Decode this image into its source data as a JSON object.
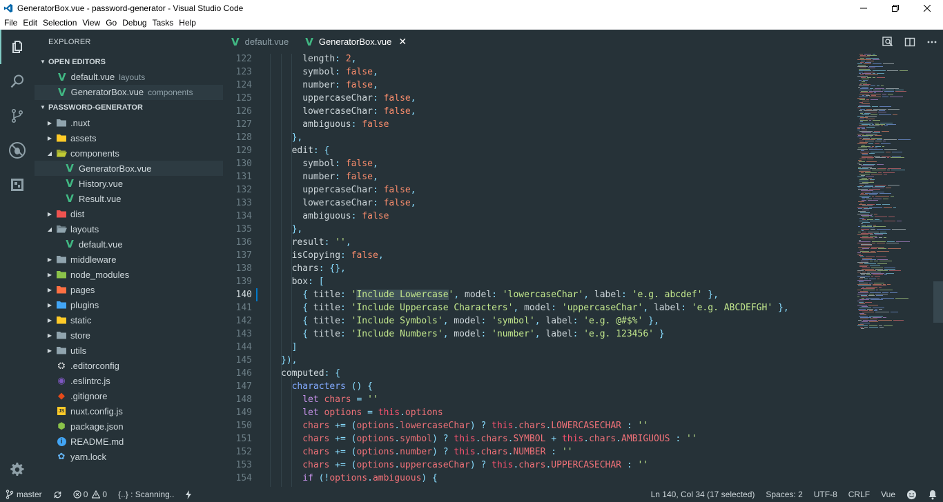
{
  "window": {
    "title": "GeneratorBox.vue - password-generator - Visual Studio Code",
    "accent": "#007acc"
  },
  "menu": [
    "File",
    "Edit",
    "Selection",
    "View",
    "Go",
    "Debug",
    "Tasks",
    "Help"
  ],
  "activity_icons": [
    "explorer-icon",
    "search-icon",
    "source-control-icon",
    "debug-icon",
    "extensions-icon",
    "settings-gear-icon"
  ],
  "sidebar": {
    "header": "EXPLORER",
    "open_editors": {
      "title": "OPEN EDITORS",
      "items": [
        {
          "name": "default.vue",
          "desc": "layouts"
        },
        {
          "name": "GeneratorBox.vue",
          "desc": "components"
        }
      ]
    },
    "project": {
      "title": "PASSWORD-GENERATOR",
      "items": [
        {
          "label": ".nuxt",
          "kind": "folder",
          "state": "closed",
          "depth": 0,
          "color": "#90a4ae"
        },
        {
          "label": "assets",
          "kind": "folder",
          "state": "closed",
          "depth": 0,
          "color": "#ffca28"
        },
        {
          "label": "components",
          "kind": "folder",
          "state": "open",
          "depth": 0,
          "color": "#c0ca33"
        },
        {
          "label": "GeneratorBox.vue",
          "kind": "vue",
          "depth": 1
        },
        {
          "label": "History.vue",
          "kind": "vue",
          "depth": 1
        },
        {
          "label": "Result.vue",
          "kind": "vue",
          "depth": 1
        },
        {
          "label": "dist",
          "kind": "folder",
          "state": "closed",
          "depth": 0,
          "color": "#ef5350"
        },
        {
          "label": "layouts",
          "kind": "folder",
          "state": "open",
          "depth": 0,
          "color": "#90a4ae"
        },
        {
          "label": "default.vue",
          "kind": "vue",
          "depth": 1
        },
        {
          "label": "middleware",
          "kind": "folder",
          "state": "closed",
          "depth": 0,
          "color": "#90a4ae"
        },
        {
          "label": "node_modules",
          "kind": "folder",
          "state": "closed",
          "depth": 0,
          "color": "#8bc34a"
        },
        {
          "label": "pages",
          "kind": "folder",
          "state": "closed",
          "depth": 0,
          "color": "#ff7043"
        },
        {
          "label": "plugins",
          "kind": "folder",
          "state": "closed",
          "depth": 0,
          "color": "#42a5f5"
        },
        {
          "label": "static",
          "kind": "folder",
          "state": "closed",
          "depth": 0,
          "color": "#ffca28"
        },
        {
          "label": "store",
          "kind": "folder",
          "state": "closed",
          "depth": 0,
          "color": "#90a4ae"
        },
        {
          "label": "utils",
          "kind": "folder",
          "state": "closed",
          "depth": 0,
          "color": "#90a4ae"
        },
        {
          "label": ".editorconfig",
          "kind": "editorconfig",
          "depth": 0
        },
        {
          "label": ".eslintrc.js",
          "kind": "eslint",
          "depth": 0
        },
        {
          "label": ".gitignore",
          "kind": "git",
          "depth": 0
        },
        {
          "label": "nuxt.config.js",
          "kind": "js",
          "depth": 0
        },
        {
          "label": "package.json",
          "kind": "npm",
          "depth": 0
        },
        {
          "label": "README.md",
          "kind": "info",
          "depth": 0
        },
        {
          "label": "yarn.lock",
          "kind": "yarn",
          "depth": 0
        }
      ]
    }
  },
  "tabs": [
    {
      "label": "default.vue",
      "active": false
    },
    {
      "label": "GeneratorBox.vue",
      "active": true
    }
  ],
  "tab_actions": [
    "open-preview-icon",
    "split-editor-icon",
    "more-actions-icon"
  ],
  "editor": {
    "current_line": 140,
    "lines": [
      {
        "n": "122",
        "i": 4,
        "t": [
          [
            "prop",
            "length"
          ],
          [
            "p",
            ": "
          ],
          [
            "n",
            "2"
          ],
          [
            "p",
            ","
          ]
        ]
      },
      {
        "n": "123",
        "i": 4,
        "t": [
          [
            "prop",
            "symbol"
          ],
          [
            "p",
            ": "
          ],
          [
            "n",
            "false"
          ],
          [
            "p",
            ","
          ]
        ]
      },
      {
        "n": "124",
        "i": 4,
        "t": [
          [
            "prop",
            "number"
          ],
          [
            "p",
            ": "
          ],
          [
            "n",
            "false"
          ],
          [
            "p",
            ","
          ]
        ]
      },
      {
        "n": "125",
        "i": 4,
        "t": [
          [
            "prop",
            "uppercaseChar"
          ],
          [
            "p",
            ": "
          ],
          [
            "n",
            "false"
          ],
          [
            "p",
            ","
          ]
        ]
      },
      {
        "n": "126",
        "i": 4,
        "t": [
          [
            "prop",
            "lowercaseChar"
          ],
          [
            "p",
            ": "
          ],
          [
            "n",
            "false"
          ],
          [
            "p",
            ","
          ]
        ]
      },
      {
        "n": "127",
        "i": 4,
        "t": [
          [
            "prop",
            "ambiguous"
          ],
          [
            "p",
            ": "
          ],
          [
            "n",
            "false"
          ]
        ]
      },
      {
        "n": "128",
        "i": 3,
        "t": [
          [
            "p",
            "},"
          ]
        ]
      },
      {
        "n": "129",
        "i": 3,
        "t": [
          [
            "prop",
            "edit"
          ],
          [
            "p",
            ": {"
          ]
        ]
      },
      {
        "n": "130",
        "i": 4,
        "t": [
          [
            "prop",
            "symbol"
          ],
          [
            "p",
            ": "
          ],
          [
            "n",
            "false"
          ],
          [
            "p",
            ","
          ]
        ]
      },
      {
        "n": "131",
        "i": 4,
        "t": [
          [
            "prop",
            "number"
          ],
          [
            "p",
            ": "
          ],
          [
            "n",
            "false"
          ],
          [
            "p",
            ","
          ]
        ]
      },
      {
        "n": "132",
        "i": 4,
        "t": [
          [
            "prop",
            "uppercaseChar"
          ],
          [
            "p",
            ": "
          ],
          [
            "n",
            "false"
          ],
          [
            "p",
            ","
          ]
        ]
      },
      {
        "n": "133",
        "i": 4,
        "t": [
          [
            "prop",
            "lowercaseChar"
          ],
          [
            "p",
            ": "
          ],
          [
            "n",
            "false"
          ],
          [
            "p",
            ","
          ]
        ]
      },
      {
        "n": "134",
        "i": 4,
        "t": [
          [
            "prop",
            "ambiguous"
          ],
          [
            "p",
            ": "
          ],
          [
            "n",
            "false"
          ]
        ]
      },
      {
        "n": "135",
        "i": 3,
        "t": [
          [
            "p",
            "},"
          ]
        ]
      },
      {
        "n": "136",
        "i": 3,
        "t": [
          [
            "prop",
            "result"
          ],
          [
            "p",
            ": "
          ],
          [
            "s",
            "''"
          ],
          [
            "p",
            ","
          ]
        ]
      },
      {
        "n": "137",
        "i": 3,
        "t": [
          [
            "prop",
            "isCopying"
          ],
          [
            "p",
            ": "
          ],
          [
            "n",
            "false"
          ],
          [
            "p",
            ","
          ]
        ]
      },
      {
        "n": "138",
        "i": 3,
        "t": [
          [
            "prop",
            "chars"
          ],
          [
            "p",
            ": {},"
          ]
        ]
      },
      {
        "n": "139",
        "i": 3,
        "t": [
          [
            "prop",
            "box"
          ],
          [
            "p",
            ": ["
          ]
        ]
      },
      {
        "n": "140",
        "i": 4,
        "t": [
          [
            "p",
            "{ "
          ],
          [
            "prop",
            "title"
          ],
          [
            "p",
            ": "
          ],
          [
            "s",
            "'"
          ],
          [
            "sel",
            "Include Lowercase"
          ],
          [
            "s",
            "'"
          ],
          [
            "p",
            ", "
          ],
          [
            "prop",
            "model"
          ],
          [
            "p",
            ": "
          ],
          [
            "s",
            "'lowercaseChar'"
          ],
          [
            "p",
            ", "
          ],
          [
            "prop",
            "label"
          ],
          [
            "p",
            ": "
          ],
          [
            "s",
            "'e.g. abcdef'"
          ],
          [
            "p",
            " },"
          ]
        ]
      },
      {
        "n": "141",
        "i": 4,
        "t": [
          [
            "p",
            "{ "
          ],
          [
            "prop",
            "title"
          ],
          [
            "p",
            ": "
          ],
          [
            "s",
            "'Include Uppercase Characters'"
          ],
          [
            "p",
            ", "
          ],
          [
            "prop",
            "model"
          ],
          [
            "p",
            ": "
          ],
          [
            "s",
            "'uppercaseChar'"
          ],
          [
            "p",
            ", "
          ],
          [
            "prop",
            "label"
          ],
          [
            "p",
            ": "
          ],
          [
            "s",
            "'e.g. ABCDEFGH'"
          ],
          [
            "p",
            " },"
          ]
        ]
      },
      {
        "n": "142",
        "i": 4,
        "t": [
          [
            "p",
            "{ "
          ],
          [
            "prop",
            "title"
          ],
          [
            "p",
            ": "
          ],
          [
            "s",
            "'Include Symbols'"
          ],
          [
            "p",
            ", "
          ],
          [
            "prop",
            "model"
          ],
          [
            "p",
            ": "
          ],
          [
            "s",
            "'symbol'"
          ],
          [
            "p",
            ", "
          ],
          [
            "prop",
            "label"
          ],
          [
            "p",
            ": "
          ],
          [
            "s",
            "'e.g. @#$%'"
          ],
          [
            "p",
            " },"
          ]
        ]
      },
      {
        "n": "143",
        "i": 4,
        "t": [
          [
            "p",
            "{ "
          ],
          [
            "prop",
            "title"
          ],
          [
            "p",
            ": "
          ],
          [
            "s",
            "'Include Numbers'"
          ],
          [
            "p",
            ", "
          ],
          [
            "prop",
            "model"
          ],
          [
            "p",
            ": "
          ],
          [
            "s",
            "'number'"
          ],
          [
            "p",
            ", "
          ],
          [
            "prop",
            "label"
          ],
          [
            "p",
            ": "
          ],
          [
            "s",
            "'e.g. 123456'"
          ],
          [
            "p",
            " }"
          ]
        ]
      },
      {
        "n": "144",
        "i": 3,
        "t": [
          [
            "p",
            "]"
          ]
        ]
      },
      {
        "n": "145",
        "i": 2,
        "t": [
          [
            "p",
            "}),"
          ]
        ]
      },
      {
        "n": "146",
        "i": 2,
        "t": [
          [
            "prop",
            "computed"
          ],
          [
            "p",
            ": {"
          ]
        ]
      },
      {
        "n": "147",
        "i": 3,
        "t": [
          [
            "fn",
            "characters"
          ],
          [
            "p",
            " () {"
          ]
        ]
      },
      {
        "n": "148",
        "i": 4,
        "t": [
          [
            "kw",
            "let "
          ],
          [
            "vr",
            "chars"
          ],
          [
            "p",
            " = "
          ],
          [
            "s",
            "''"
          ]
        ]
      },
      {
        "n": "149",
        "i": 4,
        "t": [
          [
            "kw",
            "let "
          ],
          [
            "vr",
            "options"
          ],
          [
            "p",
            " = "
          ],
          [
            "th",
            "this"
          ],
          [
            "p",
            "."
          ],
          [
            "vr",
            "options"
          ]
        ]
      },
      {
        "n": "150",
        "i": 4,
        "t": [
          [
            "vr",
            "chars"
          ],
          [
            "p",
            " += ("
          ],
          [
            "vr",
            "options"
          ],
          [
            "p",
            "."
          ],
          [
            "vr",
            "lowercaseChar"
          ],
          [
            "p",
            ") ? "
          ],
          [
            "th",
            "this"
          ],
          [
            "p",
            "."
          ],
          [
            "vr",
            "chars"
          ],
          [
            "p",
            "."
          ],
          [
            "cst",
            "LOWERCASECHAR"
          ],
          [
            "p",
            " : "
          ],
          [
            "s",
            "''"
          ]
        ]
      },
      {
        "n": "151",
        "i": 4,
        "t": [
          [
            "vr",
            "chars"
          ],
          [
            "p",
            " += ("
          ],
          [
            "vr",
            "options"
          ],
          [
            "p",
            "."
          ],
          [
            "vr",
            "symbol"
          ],
          [
            "p",
            ") ? "
          ],
          [
            "th",
            "this"
          ],
          [
            "p",
            "."
          ],
          [
            "vr",
            "chars"
          ],
          [
            "p",
            "."
          ],
          [
            "cst",
            "SYMBOL"
          ],
          [
            "p",
            " + "
          ],
          [
            "th",
            "this"
          ],
          [
            "p",
            "."
          ],
          [
            "vr",
            "chars"
          ],
          [
            "p",
            "."
          ],
          [
            "cst",
            "AMBIGUOUS"
          ],
          [
            "p",
            " : "
          ],
          [
            "s",
            "''"
          ]
        ]
      },
      {
        "n": "152",
        "i": 4,
        "t": [
          [
            "vr",
            "chars"
          ],
          [
            "p",
            " += ("
          ],
          [
            "vr",
            "options"
          ],
          [
            "p",
            "."
          ],
          [
            "vr",
            "number"
          ],
          [
            "p",
            ") ? "
          ],
          [
            "th",
            "this"
          ],
          [
            "p",
            "."
          ],
          [
            "vr",
            "chars"
          ],
          [
            "p",
            "."
          ],
          [
            "cst",
            "NUMBER"
          ],
          [
            "p",
            " : "
          ],
          [
            "s",
            "''"
          ]
        ]
      },
      {
        "n": "153",
        "i": 4,
        "t": [
          [
            "vr",
            "chars"
          ],
          [
            "p",
            " += ("
          ],
          [
            "vr",
            "options"
          ],
          [
            "p",
            "."
          ],
          [
            "vr",
            "uppercaseChar"
          ],
          [
            "p",
            ") ? "
          ],
          [
            "th",
            "this"
          ],
          [
            "p",
            "."
          ],
          [
            "vr",
            "chars"
          ],
          [
            "p",
            "."
          ],
          [
            "cst",
            "UPPERCASECHAR"
          ],
          [
            "p",
            " : "
          ],
          [
            "s",
            "''"
          ]
        ]
      },
      {
        "n": "154",
        "i": 4,
        "t": [
          [
            "kw",
            "if "
          ],
          [
            "p",
            "(!"
          ],
          [
            "vr",
            "options"
          ],
          [
            "p",
            "."
          ],
          [
            "vr",
            "ambiguous"
          ],
          [
            "p",
            ") {"
          ]
        ]
      }
    ]
  },
  "statusbar": {
    "branch": "master",
    "errors": "0",
    "warnings": "0",
    "scanning": "{..} : Scanning..",
    "position": "Ln 140, Col 34 (17 selected)",
    "spaces": "Spaces: 2",
    "encoding": "UTF-8",
    "eol": "CRLF",
    "language": "Vue"
  }
}
